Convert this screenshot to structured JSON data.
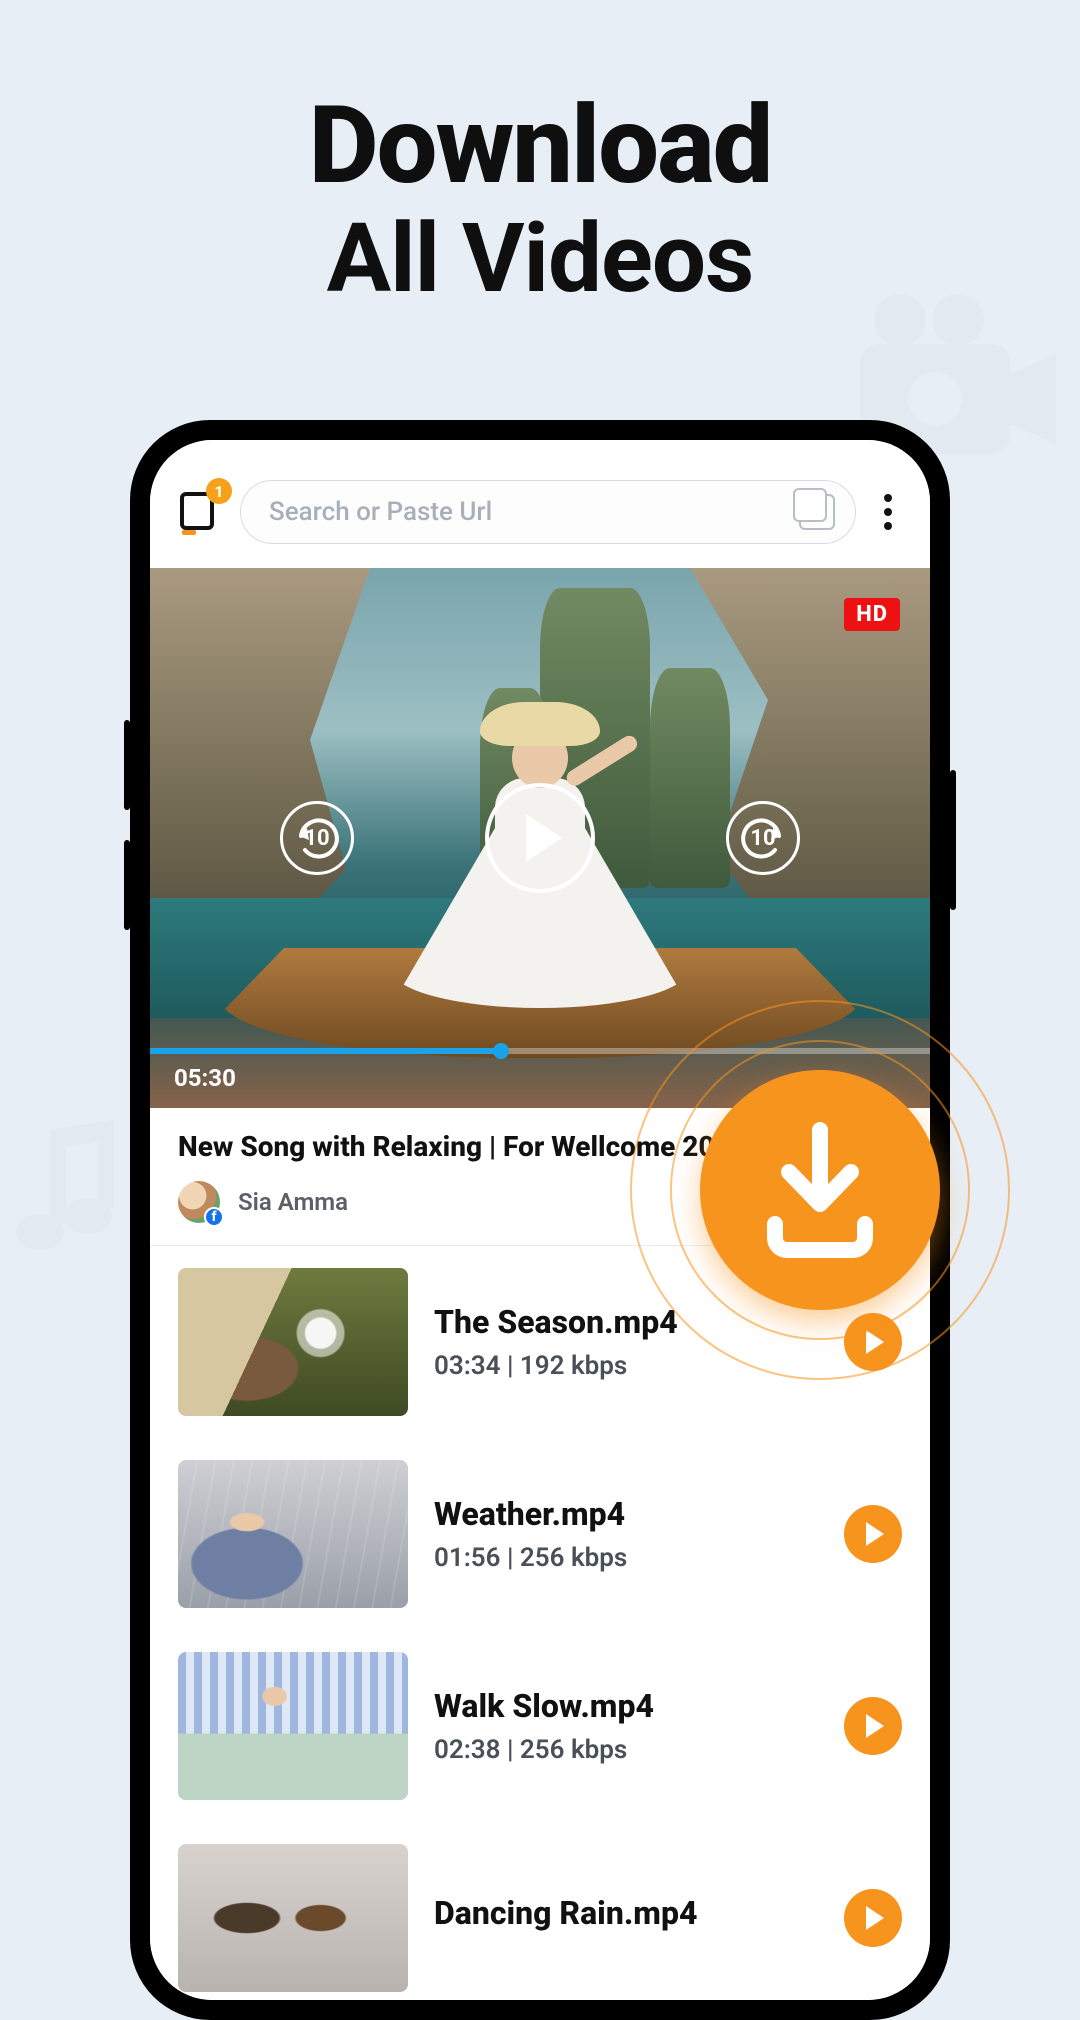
{
  "headline": {
    "line1": "Download",
    "line2": "All Videos"
  },
  "topbar": {
    "tab_badge": "1",
    "search_placeholder": "Search or Paste Url"
  },
  "player": {
    "hd_label": "HD",
    "rewind_seconds": "10",
    "forward_seconds": "10",
    "elapsed": "05:30",
    "progress_percent": 45
  },
  "video": {
    "title": "New Song with Relaxing | For Wellcome 2024",
    "author": "Sia Amma"
  },
  "list": [
    {
      "thumb": "season",
      "name": "The Season.mp4",
      "duration": "03:34",
      "bitrate": "192 kbps"
    },
    {
      "thumb": "weather",
      "name": "Weather.mp4",
      "duration": "01:56",
      "bitrate": "256 kbps"
    },
    {
      "thumb": "walk",
      "name": "Walk Slow.mp4",
      "duration": "02:38",
      "bitrate": "256 kbps"
    },
    {
      "thumb": "rain",
      "name": "Dancing Rain.mp4",
      "duration": "",
      "bitrate": ""
    }
  ],
  "colors": {
    "accent": "#f7941e",
    "hd": "#e11",
    "progress": "#1aa3ea"
  }
}
